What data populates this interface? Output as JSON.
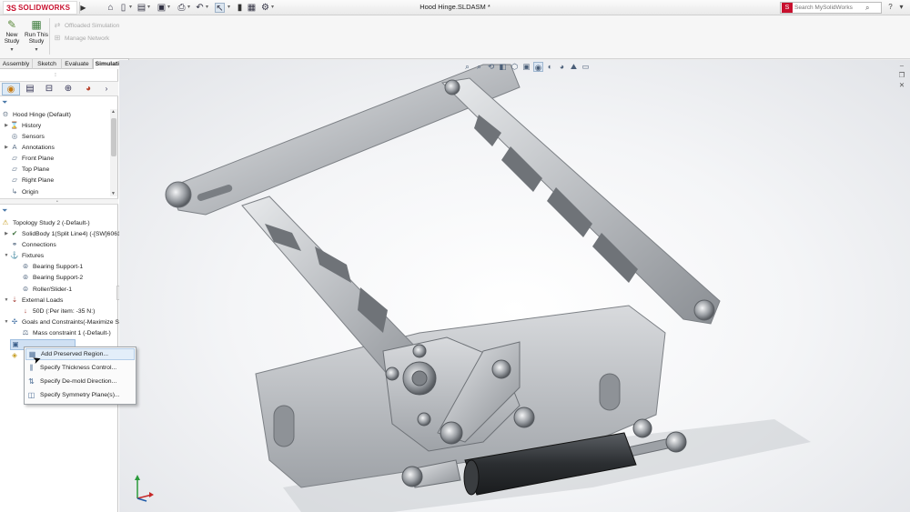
{
  "app": {
    "brand": "SOLIDWORKS",
    "brand_mark": "3S",
    "document_title": "Hood Hinge.SLDASM *",
    "search_placeholder": "Search MySolidWorks"
  },
  "toolbar": {
    "quick_access": [
      "home-icon",
      "new-document-icon",
      "open-folder-icon",
      "save-icon",
      "print-icon",
      "undo-icon",
      "select-arrow-icon",
      "rebuild-traffic-light-icon",
      "file-properties-icon",
      "options-gear-icon"
    ]
  },
  "command_manager": {
    "new_study_label_1": "New",
    "new_study_label_2": "Study",
    "run_study_label_1": "Run This",
    "run_study_label_2": "Study",
    "offloaded_label": "Offloaded Simulation",
    "manage_network_label": "Manage Network"
  },
  "tabs": [
    {
      "label": "Assembly",
      "active": false
    },
    {
      "label": "Sketch",
      "active": false
    },
    {
      "label": "Evaluate",
      "active": false
    },
    {
      "label": "Simulation",
      "active": true
    }
  ],
  "feature_tree": {
    "root": "Hood Hinge  (Default)",
    "items": [
      {
        "label": "History",
        "icon": "history-icon"
      },
      {
        "label": "Sensors",
        "icon": "sensors-icon"
      },
      {
        "label": "Annotations",
        "icon": "annotations-icon"
      },
      {
        "label": "Front Plane",
        "icon": "plane-icon"
      },
      {
        "label": "Top Plane",
        "icon": "plane-icon"
      },
      {
        "label": "Right Plane",
        "icon": "plane-icon"
      },
      {
        "label": "Origin",
        "icon": "origin-icon"
      }
    ]
  },
  "study_tree": {
    "study": "Topology Study 2 (-Default-)",
    "solid_body": "SolidBody 1(Split Line4) (-[SW]6061",
    "connections": "Connections",
    "fixtures": "Fixtures",
    "fixture_items": [
      "Bearing Support-1",
      "Bearing Support-2",
      "Roller/Slider-1"
    ],
    "external_loads": "External Loads",
    "load_item": "50D (:Per item: -35 N:)",
    "goals": "Goals and Constraints(-Maximize S",
    "mass_constraint": "Mass constraint 1 (-Default-)"
  },
  "context_menu": {
    "items": [
      "Add Preserved Region...",
      "Specify Thickness Control...",
      "Specify De-mold Direction...",
      "Specify Symmetry Plane(s)..."
    ]
  },
  "colors": {
    "brand_red": "#c8102e",
    "part_metal": "#b9bcc0",
    "damper_dark": "#35383c",
    "selection_blue": "#e3eef9"
  }
}
